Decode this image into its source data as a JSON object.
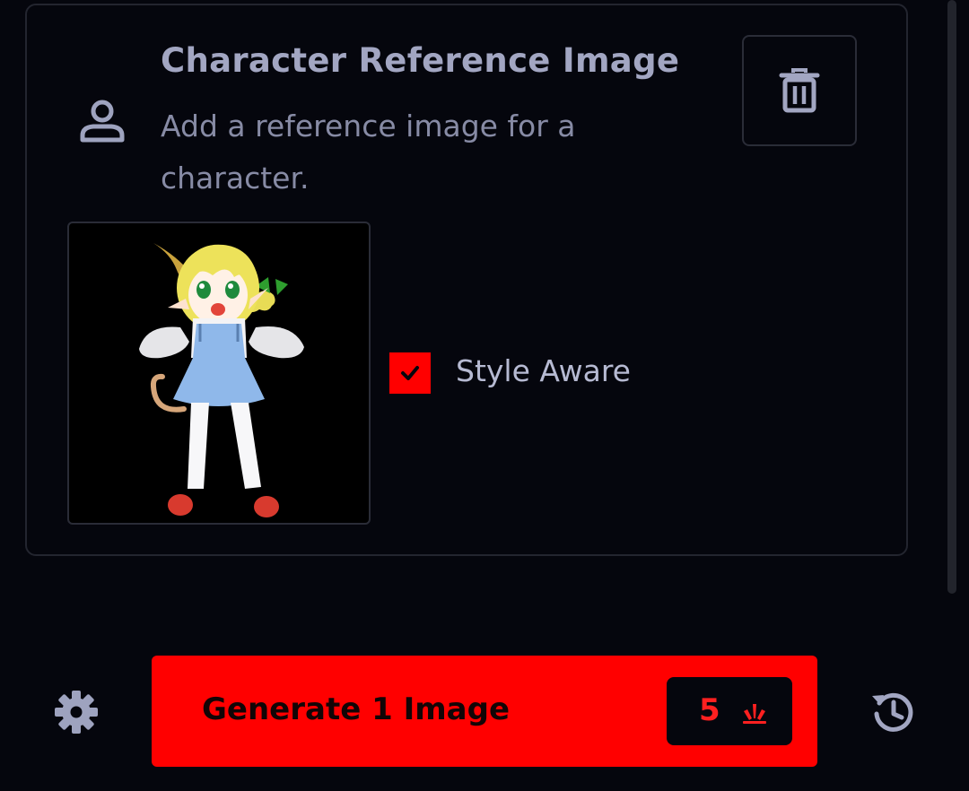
{
  "card": {
    "title": "Character Reference Image",
    "subtitle": "Add a reference image for a character.",
    "icon": "person-icon",
    "delete_icon": "trash-icon",
    "style_aware": {
      "label": "Style Aware",
      "checked": true
    }
  },
  "footer": {
    "settings_icon": "gear-icon",
    "generate_label": "Generate 1 Image",
    "cost": "5",
    "cost_icon": "spark-icon",
    "history_icon": "history-icon"
  },
  "colors": {
    "background": "#05060d",
    "accent": "#ff0000",
    "text_primary": "#a2a6c2",
    "text_secondary": "#878ba5",
    "border": "#23252f"
  }
}
